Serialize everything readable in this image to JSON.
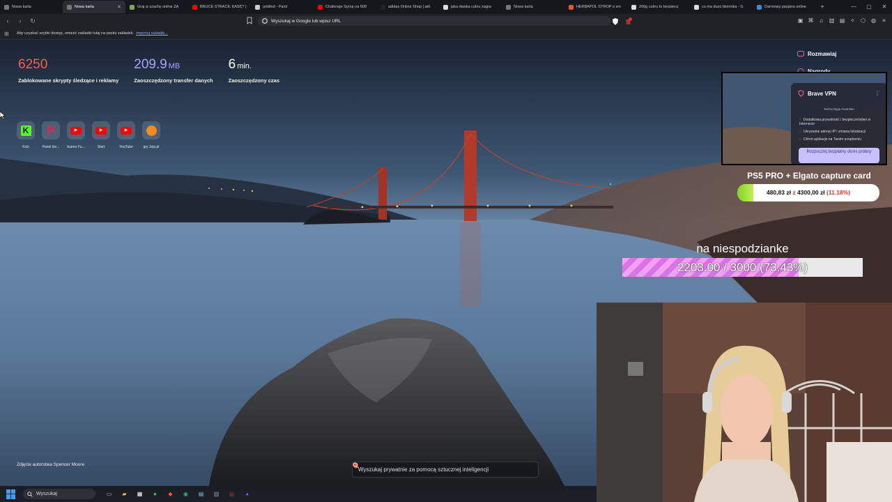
{
  "tabs": [
    {
      "title": "Nowa karta",
      "active": false,
      "favicon_color": "#777777"
    },
    {
      "title": "Nowa karta",
      "active": true,
      "favicon_color": "#777777"
    },
    {
      "title": "Graj w szachy online ZA",
      "active": false,
      "favicon_color": "#7fa650"
    },
    {
      "title": "BRUCE STRACIŁ KASĘ? (",
      "active": false,
      "favicon_color": "#ff0000"
    },
    {
      "title": "untitled - Paint",
      "active": false,
      "favicon_color": "#cccccc"
    },
    {
      "title": "Challenge Syrop na 600",
      "active": false,
      "favicon_color": "#ff0000"
    },
    {
      "title": "adidas Online Shop | adi",
      "active": false,
      "favicon_color": "#222222"
    },
    {
      "title": "jaka dawka cukru zagra",
      "active": false,
      "favicon_color": "#dddddd"
    },
    {
      "title": "Nowa karta",
      "active": false,
      "favicon_color": "#777777"
    },
    {
      "title": "HERBAPOL SYROP o sm",
      "active": false,
      "favicon_color": "#e05a2b"
    },
    {
      "title": "200g cukru to bezpiecz",
      "active": false,
      "favicon_color": "#dddddd"
    },
    {
      "title": "co ma duzo blonnika - G",
      "active": false,
      "favicon_color": "#dddddd"
    },
    {
      "title": "Darmowy pasjans online",
      "active": false,
      "favicon_color": "#3a8bd6"
    }
  ],
  "icons": {
    "new_tab": "plus-icon",
    "minimize": "minimize-icon",
    "maximize": "maximize-icon",
    "close": "close-icon"
  },
  "address_bar": {
    "placeholder": "Wyszukaj w Google lub wpisz URL"
  },
  "bookmarks_bar": {
    "message": "Aby uzyskać szybki dostęp, umieść zakładki tutaj na pasku zakładek.",
    "import_link": "Importuj zakładki..."
  },
  "stats": [
    {
      "value": "6250",
      "unit": "",
      "label": "Zablokowane skrypty śledzące i reklamy",
      "color": "#ff5a4a"
    },
    {
      "value": "209.9",
      "unit": "MB",
      "label": "Zaoszczędzony transfer danych",
      "color": "#a3a8ff"
    },
    {
      "value": "6",
      "unit": "min.",
      "label": "Zaoszczędzony czas",
      "color": "#ffffff"
    }
  ],
  "top_sites": [
    {
      "label": "Kick",
      "icon": "kick-icon",
      "color": "#53fc18"
    },
    {
      "label": "Panel kie...",
      "icon": "patronite-icon",
      "color": "#e8234a"
    },
    {
      "label": "bueno Fu...",
      "icon": "youtube-icon",
      "color": "#ff0000"
    },
    {
      "label": "Start",
      "icon": "youtube-icon",
      "color": "#ff0000"
    },
    {
      "label": "YouTube",
      "icon": "youtube-icon",
      "color": "#ff0000"
    },
    {
      "label": "gry Jeja.pl",
      "icon": "jeja-icon",
      "color": "#f28b1f"
    }
  ],
  "photo_credit": "Zdjęcie autorstwa Spencer Moore",
  "ai_search": {
    "placeholder": "Wyszukaj prywatnie za pomocą sztucznej inteligencji"
  },
  "sidebar": {
    "chat_label": "Rozmawiaj",
    "rewards_label": "Nagrody"
  },
  "vpn": {
    "title": "Brave VPN",
    "tech": "Technologia Guardian",
    "features": [
      "Dodatkowa prywatność i bezpieczeństwo w Internecie",
      "Ukrywanie adresu IP i zmiana lokalizacji",
      "Chroń aplikacje na Twoim urządzeniu"
    ],
    "cta": "Rozpocznij bezpłatny okres próbny"
  },
  "goal1": {
    "title": "PS5 PRO + Elgato capture card",
    "current": "480,83 zł",
    "separator": "z",
    "target": "4300,00 zł",
    "percent_text": "(11.18%)",
    "fraction": 0.1118
  },
  "goal2": {
    "title": "na niespodzianke",
    "text": "2203.00 / 3000 (73.43%)",
    "fraction": 0.7343
  },
  "taskbar": {
    "search_label": "Wyszukaj",
    "apps": [
      {
        "icon": "task-view-icon",
        "color": "#cfd3da"
      },
      {
        "icon": "file-explorer-icon",
        "color": "#f5c542"
      },
      {
        "icon": "store-icon",
        "color": "#ffffff"
      },
      {
        "icon": "spotify-icon",
        "color": "#1ed760"
      },
      {
        "icon": "brave-icon",
        "color": "#fb542b"
      },
      {
        "icon": "edge-icon",
        "color": "#36b37e"
      },
      {
        "icon": "notepad-icon",
        "color": "#7cc3f5"
      },
      {
        "icon": "calculator-icon",
        "color": "#9aa3b0"
      },
      {
        "icon": "chrome-icon",
        "color": "#e84133"
      },
      {
        "icon": "messenger-icon",
        "color": "#8a5cff"
      }
    ]
  }
}
